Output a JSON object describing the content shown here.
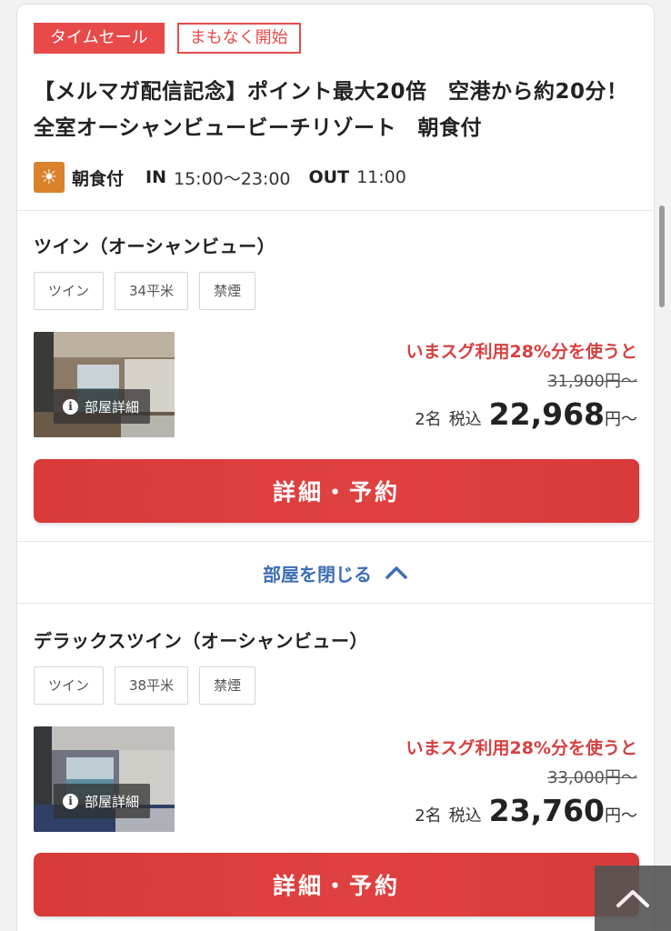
{
  "badges": {
    "sale": "タイムセール",
    "soon": "まもなく開始"
  },
  "plan": {
    "title": "【メルマガ配信記念】ポイント最大20倍　空港から約20分！全室オーシャンビュービーチリゾート　朝食付",
    "meal": "朝食付",
    "in_label": "IN",
    "in_time": "15:00〜23:00",
    "out_label": "OUT",
    "out_time": "11:00"
  },
  "photo_detail_label": "部屋詳細",
  "rooms": [
    {
      "name": "ツイン（オーシャンビュー）",
      "tags": [
        "ツイン",
        "34平米",
        "禁煙"
      ],
      "promo": "いまスグ利用28%分を使うと",
      "original_price": "31,900円〜",
      "guests": "2名",
      "tax": "税込",
      "price": "22,968",
      "yen": "円〜",
      "button": "詳細・予約"
    },
    {
      "name": "デラックスツイン（オーシャンビュー）",
      "tags": [
        "ツイン",
        "38平米",
        "禁煙"
      ],
      "promo": "いまスグ利用28%分を使うと",
      "original_price": "33,000円〜",
      "guests": "2名",
      "tax": "税込",
      "price": "23,760",
      "yen": "円〜",
      "button": "詳細・予約"
    }
  ],
  "close_rooms": "部屋を閉じる",
  "icons": {
    "meal": "sun-icon",
    "info": "info-icon",
    "collapse": "chevron-up-icon",
    "scroll_top": "back-to-top-icon"
  },
  "colors": {
    "accent_red": "#e84a4a",
    "link_blue": "#3d6db5",
    "meal_orange": "#d9822b"
  }
}
